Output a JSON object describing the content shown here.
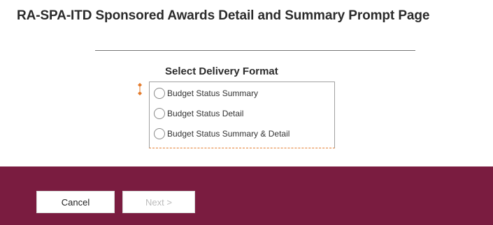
{
  "page": {
    "title": "RA-SPA-ITD Sponsored Awards Detail and Summary Prompt Page"
  },
  "delivery_format": {
    "heading": "Select Delivery Format",
    "required": true,
    "selected": null,
    "options": [
      {
        "label": "Budget Status Summary"
      },
      {
        "label": "Budget Status Detail"
      },
      {
        "label": "Budget Status Summary & Detail"
      }
    ]
  },
  "footer": {
    "cancel_label": "Cancel",
    "next_label": "Next >",
    "next_enabled": false
  },
  "colors": {
    "footer_background": "#7a1c40",
    "required_marker": "#e37b2c",
    "disabled_text": "#bcbcbc"
  }
}
